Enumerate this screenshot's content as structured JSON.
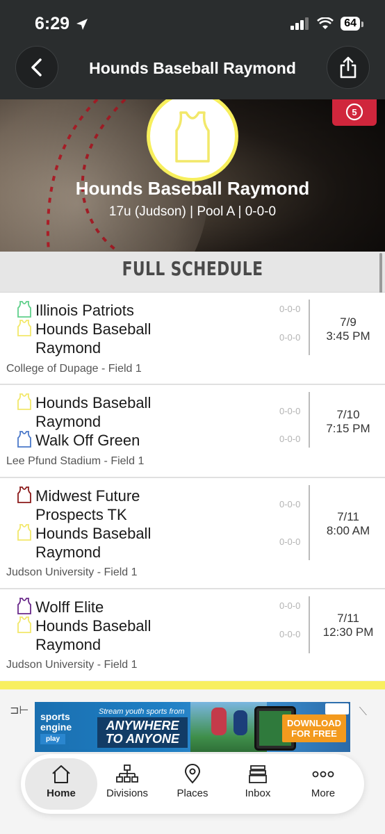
{
  "status": {
    "time": "6:29",
    "battery": "64"
  },
  "header": {
    "title": "Hounds Baseball Raymond"
  },
  "hero": {
    "team_name": "Hounds Baseball Raymond",
    "subtitle": "17u (Judson) | Pool A | 0-0-0"
  },
  "schedule": {
    "title": "FULL SCHEDULE",
    "games": [
      {
        "away": {
          "name": "Illinois Patriots",
          "record": "0-0-0",
          "jersey_color": "#5fcf8a"
        },
        "home": {
          "name": "Hounds Baseball Raymond",
          "record": "0-0-0",
          "jersey_color": "#f2e86a"
        },
        "date": "7/9",
        "time": "3:45 PM",
        "venue": "College of Dupage - Field 1"
      },
      {
        "away": {
          "name": "Hounds Baseball Raymond",
          "record": "0-0-0",
          "jersey_color": "#f2e86a"
        },
        "home": {
          "name": "Walk Off Green",
          "record": "0-0-0",
          "jersey_color": "#4a78c9"
        },
        "date": "7/10",
        "time": "7:15 PM",
        "venue": "Lee Pfund Stadium - Field 1"
      },
      {
        "away": {
          "name": "Midwest Future Prospects TK",
          "record": "0-0-0",
          "jersey_color": "#8b1a1a"
        },
        "home": {
          "name": "Hounds Baseball Raymond",
          "record": "0-0-0",
          "jersey_color": "#f2e86a"
        },
        "date": "7/11",
        "time": "8:00 AM",
        "venue": "Judson University - Field 1"
      },
      {
        "away": {
          "name": "Wolff Elite",
          "record": "0-0-0",
          "jersey_color": "#6a2a8a"
        },
        "home": {
          "name": "Hounds Baseball Raymond",
          "record": "0-0-0",
          "jersey_color": "#f2e86a"
        },
        "date": "7/11",
        "time": "12:30 PM",
        "venue": "Judson University - Field 1"
      }
    ]
  },
  "ad": {
    "logo_line1": "sports",
    "logo_line2": "engine",
    "logo_line3": "play",
    "stream_text": "Stream youth sports from",
    "headline_1": "ANYWHERE",
    "headline_2": "TO ANYONE",
    "cta_1": "DOWNLOAD",
    "cta_2": "FOR FREE"
  },
  "tabs": [
    {
      "label": "Home",
      "icon": "home-icon",
      "active": true
    },
    {
      "label": "Divisions",
      "icon": "divisions-icon",
      "active": false
    },
    {
      "label": "Places",
      "icon": "location-pin-icon",
      "active": false
    },
    {
      "label": "Inbox",
      "icon": "inbox-icon",
      "active": false
    },
    {
      "label": "More",
      "icon": "more-dots-icon",
      "active": false
    }
  ],
  "colors": {
    "accent_yellow": "#f8ef60",
    "live_red": "#d0263c",
    "header_bg": "#2a2d2e"
  }
}
